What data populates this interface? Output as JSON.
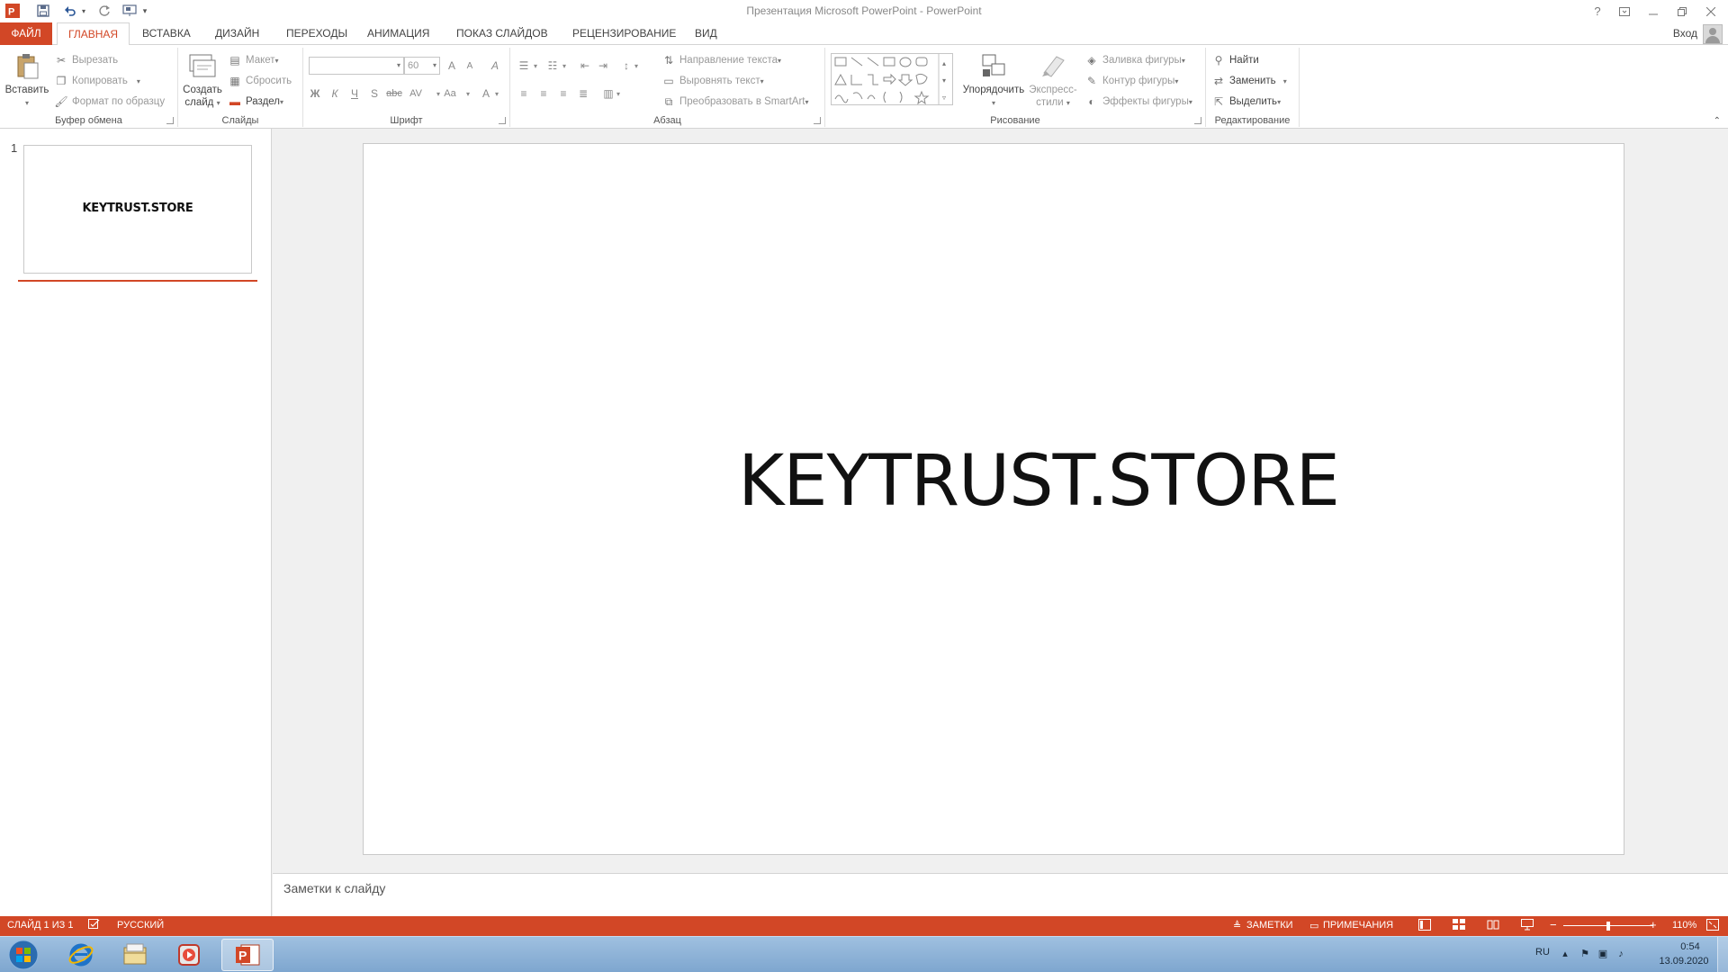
{
  "titlebar": {
    "title": "Презентация Microsoft PowerPoint - PowerPoint",
    "help": "?",
    "signin": "Вход"
  },
  "tabs": {
    "file": "ФАЙЛ",
    "home": "ГЛАВНАЯ",
    "insert": "ВСТАВКА",
    "design": "ДИЗАЙН",
    "transitions": "ПЕРЕХОДЫ",
    "animations": "АНИМАЦИЯ",
    "slideshow": "ПОКАЗ СЛАЙДОВ",
    "review": "РЕЦЕНЗИРОВАНИЕ",
    "view": "ВИД"
  },
  "ribbon": {
    "clipboard": {
      "label": "Буфер обмена",
      "paste": "Вставить",
      "cut": "Вырезать",
      "copy": "Копировать",
      "format_painter": "Формат по образцу"
    },
    "slides": {
      "label": "Слайды",
      "new_slide_1": "Создать",
      "new_slide_2": "слайд",
      "layout": "Макет",
      "reset": "Сбросить",
      "section": "Раздел"
    },
    "font": {
      "label": "Шрифт",
      "size": "60",
      "grow": "A",
      "shrink": "A",
      "clear": "A",
      "bold": "Ж",
      "italic": "К",
      "underline": "Ч",
      "shadow": "S",
      "strike": "abc",
      "spacing": "AV",
      "case": "Aa",
      "color": "A"
    },
    "paragraph": {
      "label": "Абзац",
      "text_direction": "Направление текста",
      "align_text": "Выровнять текст",
      "smartart": "Преобразовать в SmartArt"
    },
    "drawing": {
      "label": "Рисование",
      "arrange": "Упорядочить",
      "quick_styles_1": "Экспресс-",
      "quick_styles_2": "стили",
      "shape_fill": "Заливка фигуры",
      "shape_outline": "Контур фигуры",
      "shape_effects": "Эффекты фигуры"
    },
    "editing": {
      "label": "Редактирование",
      "find": "Найти",
      "replace": "Заменить",
      "select": "Выделить"
    }
  },
  "thumbnails": [
    {
      "number": "1",
      "text": "KEYTRUST.STORE"
    }
  ],
  "slide": {
    "text": "KEYTRUST.STORE"
  },
  "notes": {
    "placeholder": "Заметки к слайду"
  },
  "statusbar": {
    "slide_info": "СЛАЙД 1 ИЗ 1",
    "language": "РУССКИЙ",
    "notes": "ЗАМЕТКИ",
    "comments": "ПРИМЕЧАНИЯ",
    "zoom_minus": "−",
    "zoom_plus": "+",
    "zoom": "110%",
    "zoom_fraction": 0.5
  },
  "taskbar": {
    "lang": "RU",
    "time": "0:54",
    "date": "13.09.2020"
  },
  "colors": {
    "accent": "#d24726"
  }
}
